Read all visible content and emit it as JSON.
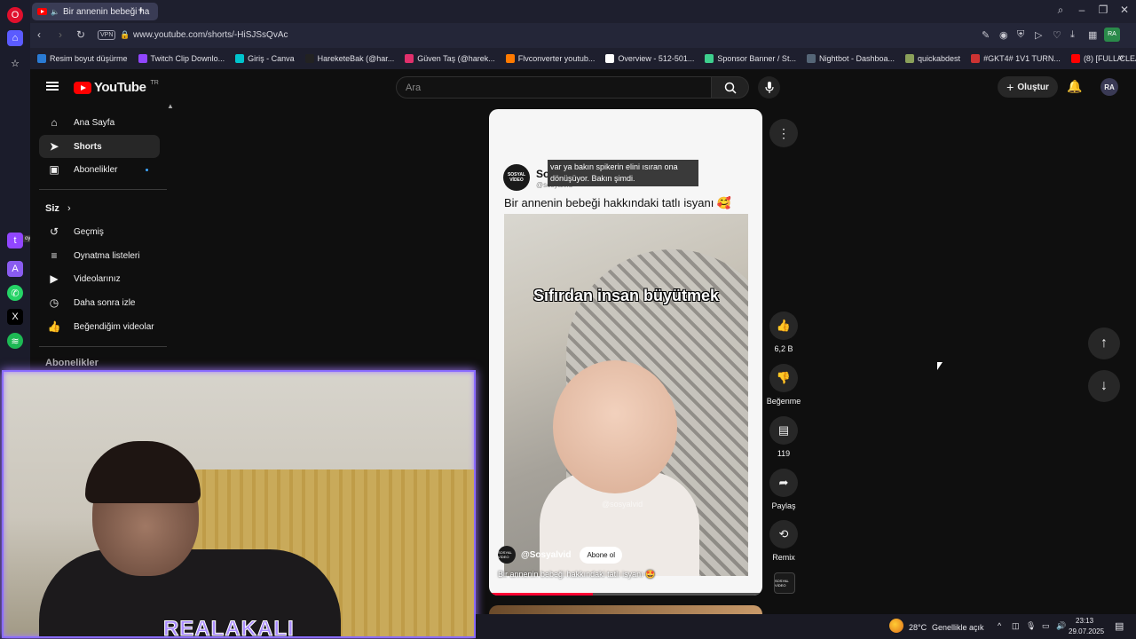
{
  "browser": {
    "tab_title": "Bir annenin bebeği ha",
    "url": "www.youtube.com/shorts/-HiSJSsQvAc",
    "vpn_label": "VPN",
    "bookmarks": [
      {
        "label": "Resim boyut düşürme",
        "color": "#2a7bd4"
      },
      {
        "label": "Twitch Clip Downlo...",
        "color": "#9146ff"
      },
      {
        "label": "Giriş - Canva",
        "color": "#00c4cc"
      },
      {
        "label": "HareketeBak (@har...",
        "color": "#222222"
      },
      {
        "label": "Güven Taş (@harek...",
        "color": "#e1306c"
      },
      {
        "label": "Flvconverter youtub...",
        "color": "#ff7a00"
      },
      {
        "label": "Overview - 512-501...",
        "color": "#ffffff"
      },
      {
        "label": "Sponsor Banner / St...",
        "color": "#3ecf8e"
      },
      {
        "label": "Nightbot - Dashboa...",
        "color": "#556677"
      },
      {
        "label": "quickabdest",
        "color": "#8aa05a"
      },
      {
        "label": "#GKT4# 1V1 TURN...",
        "color": "#cc3333"
      },
      {
        "label": "(8) [FULL/CLEAN AU...",
        "color": "#ff0000"
      }
    ]
  },
  "youtube": {
    "logo_text": "YouTube",
    "region": "TR",
    "search_placeholder": "Ara",
    "create_label": "Oluştur",
    "avatar_initials": "RA",
    "guide": {
      "main": [
        {
          "label": "Ana Sayfa",
          "icon": "home-icon",
          "glyph": "⌂"
        },
        {
          "label": "Shorts",
          "icon": "shorts-icon",
          "glyph": "➤"
        },
        {
          "label": "Abonelikler",
          "icon": "subscriptions-icon",
          "glyph": "▣"
        }
      ],
      "you_section": "Siz",
      "you": [
        {
          "label": "Geçmiş",
          "icon": "history-icon",
          "glyph": "↺"
        },
        {
          "label": "Oynatma listeleri",
          "icon": "playlists-icon",
          "glyph": "≡"
        },
        {
          "label": "Videolarınız",
          "icon": "your-videos-icon",
          "glyph": "▶"
        },
        {
          "label": "Daha sonra izle",
          "icon": "watch-later-icon",
          "glyph": "◷"
        },
        {
          "label": "Beğendiğim videolar",
          "icon": "liked-icon",
          "glyph": "👍"
        }
      ],
      "subs_section": "Abonelikler"
    },
    "short": {
      "channel_logo_text": "SOSYAL VİDEO",
      "channel_name": "Sosyalvid",
      "channel_name_partial": "So",
      "handle": "@sosyalvid",
      "caption_overlay": "var ya bakın spikerin elini ısıran ona dönüşüyor. Bakın şimdi.",
      "title": "Bir annenin bebeği hakkındaki tatlı isyanı 🥰",
      "video_overlay": "Sıfırdan insan büyütmek",
      "watermark": "@sosyalvid",
      "player_channel": "@Sosyalvid",
      "subscribe_label": "Abone ol",
      "player_caption": "Bir annenin bebeği hakkındaki tatlı isyanı 🤩",
      "progress": 0.38
    },
    "actions": {
      "likes": "6,2 B",
      "dislike_label": "Beğenme",
      "comments": "119",
      "share_label": "Paylaş",
      "remix_label": "Remix"
    }
  },
  "overlay": {
    "streamer_name": "REALAKALI",
    "side_tag": "oyunfor.com"
  },
  "taskbar": {
    "weather": "28°C",
    "weather_desc": "Genellikle açık",
    "time": "23:13",
    "date": "29.07.2025"
  }
}
